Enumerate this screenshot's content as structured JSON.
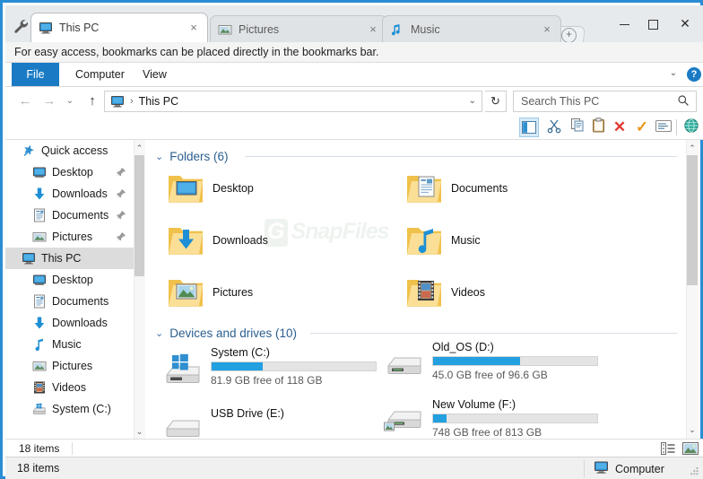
{
  "window": {
    "controls": {
      "minimize": "minimize-button",
      "maximize": "maximize-button",
      "close": "✕"
    }
  },
  "tabs": {
    "items": [
      {
        "label": "This PC",
        "icon": "monitor-icon",
        "active": true,
        "close": "×"
      },
      {
        "label": "Pictures",
        "icon": "picture-icon",
        "active": false,
        "close": "×"
      },
      {
        "label": "Music",
        "icon": "music-note-icon",
        "active": false,
        "close": "×"
      }
    ],
    "new_tab_label": "+"
  },
  "bookmark_bar": {
    "message": "For easy access, bookmarks can be placed directly in the bookmarks bar."
  },
  "ribbon": {
    "file": "File",
    "tabs": [
      "Computer",
      "View"
    ],
    "chevron": "⌄",
    "help": "?"
  },
  "address_bar": {
    "back": "←",
    "forward": "→",
    "recent": "⌄",
    "up": "↑",
    "path_icon": "monitor-icon",
    "separator": "›",
    "path": "This PC",
    "dropdown": "⌄",
    "refresh": "↻",
    "search_placeholder": "Search This PC"
  },
  "command_toolbar": {
    "icons": [
      "nav-pane-toggle-icon",
      "cut-scissors-icon",
      "copy-icon",
      "paste-clipboard-icon",
      "delete-x-icon",
      "confirm-check-icon",
      "rename-icon",
      "network-globe-icon"
    ],
    "delete_glyph": "✕",
    "confirm_glyph": "✓"
  },
  "sidebar": {
    "items": [
      {
        "label": "Quick access",
        "icon": "star-pin-icon",
        "indent": 0,
        "pinned": false,
        "selected": false
      },
      {
        "label": "Desktop",
        "icon": "desktop-icon",
        "indent": 1,
        "pinned": true,
        "selected": false
      },
      {
        "label": "Downloads",
        "icon": "download-icon",
        "indent": 1,
        "pinned": true,
        "selected": false
      },
      {
        "label": "Documents",
        "icon": "document-icon",
        "indent": 1,
        "pinned": true,
        "selected": false
      },
      {
        "label": "Pictures",
        "icon": "picture-icon",
        "indent": 1,
        "pinned": true,
        "selected": false
      },
      {
        "label": "This PC",
        "icon": "monitor-icon",
        "indent": 0,
        "pinned": false,
        "selected": true
      },
      {
        "label": "Desktop",
        "icon": "desktop-icon",
        "indent": 1,
        "pinned": false,
        "selected": false
      },
      {
        "label": "Documents",
        "icon": "document-icon",
        "indent": 1,
        "pinned": false,
        "selected": false
      },
      {
        "label": "Downloads",
        "icon": "download-icon",
        "indent": 1,
        "pinned": false,
        "selected": false
      },
      {
        "label": "Music",
        "icon": "music-note-icon",
        "indent": 1,
        "pinned": false,
        "selected": false
      },
      {
        "label": "Pictures",
        "icon": "picture-icon",
        "indent": 1,
        "pinned": false,
        "selected": false
      },
      {
        "label": "Videos",
        "icon": "video-icon",
        "indent": 1,
        "pinned": false,
        "selected": false
      },
      {
        "label": "System (C:)",
        "icon": "drive-icon",
        "indent": 1,
        "pinned": false,
        "selected": false
      }
    ],
    "scroll_up": "⌃",
    "scroll_down": "⌄"
  },
  "content": {
    "watermark": {
      "g": "G",
      "text": "SnapFiles"
    },
    "folders_group": {
      "title": "Folders (6)",
      "chevron": "⌄",
      "items": [
        {
          "label": "Desktop",
          "icon": "folder-desktop-icon"
        },
        {
          "label": "Documents",
          "icon": "folder-documents-icon"
        },
        {
          "label": "Downloads",
          "icon": "folder-downloads-icon"
        },
        {
          "label": "Music",
          "icon": "folder-music-icon"
        },
        {
          "label": "Pictures",
          "icon": "folder-pictures-icon"
        },
        {
          "label": "Videos",
          "icon": "folder-videos-icon"
        }
      ]
    },
    "drives_group": {
      "title": "Devices and drives (10)",
      "chevron": "⌄",
      "items": [
        {
          "name": "System (C:)",
          "free": "81.9 GB free of 118 GB",
          "fill_percent": 31,
          "has_bar": true,
          "icon": "windows-drive-icon"
        },
        {
          "name": "Old_OS (D:)",
          "free": "45.0 GB free of 96.6 GB",
          "fill_percent": 53,
          "has_bar": true,
          "icon": "drive-icon"
        },
        {
          "name": "USB Drive (E:)",
          "free": "",
          "fill_percent": 0,
          "has_bar": false,
          "icon": "usb-drive-icon"
        },
        {
          "name": "New Volume (F:)",
          "free": "748 GB free of 813 GB",
          "fill_percent": 8,
          "has_bar": true,
          "icon": "photo-drive-icon"
        }
      ]
    },
    "scroll_up": "⌃",
    "scroll_down": "⌄"
  },
  "explorer_status": {
    "item_count": "18 items",
    "view_details": "details-view-icon",
    "view_icons": "large-icons-view-icon"
  },
  "app_status": {
    "left_text": "18 items",
    "right_text": "Computer",
    "right_icon": "monitor-icon"
  },
  "colors": {
    "window_border": "#2a8dd4",
    "ribbon_file": "#1a7bc4",
    "accent_blue": "#22a0e0",
    "folder_yellow": "#f6d37f",
    "group_title": "#2b5f8f",
    "selection_gray": "#dcdcdc",
    "delete_red": "#e03a2f",
    "check_orange": "#e8951a"
  }
}
